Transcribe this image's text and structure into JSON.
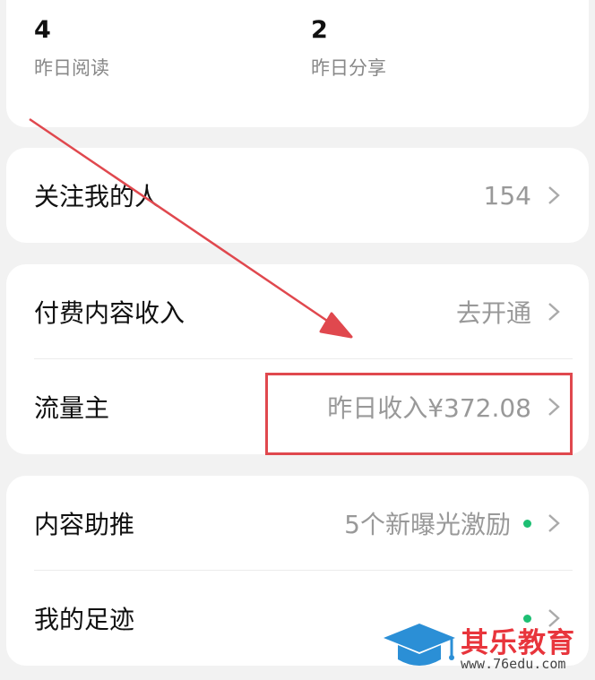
{
  "stats": [
    {
      "value": "4",
      "label": "昨日阅读"
    },
    {
      "value": "2",
      "label": "昨日分享"
    }
  ],
  "followers": {
    "label": "关注我的人",
    "value": "154"
  },
  "paid_content": {
    "label": "付费内容收入",
    "value": "去开通"
  },
  "traffic_master": {
    "label": "流量主",
    "value": "昨日收入¥372.08"
  },
  "content_boost": {
    "label": "内容助推",
    "value": "5个新曝光激励",
    "dot_color": "#1dbf73"
  },
  "my_footprints": {
    "label": "我的足迹",
    "dot_color": "#1dbf73"
  },
  "watermark": {
    "name": "其乐教育",
    "url": "www.76edu.com"
  },
  "annotation": {
    "color": "#e0484e"
  }
}
